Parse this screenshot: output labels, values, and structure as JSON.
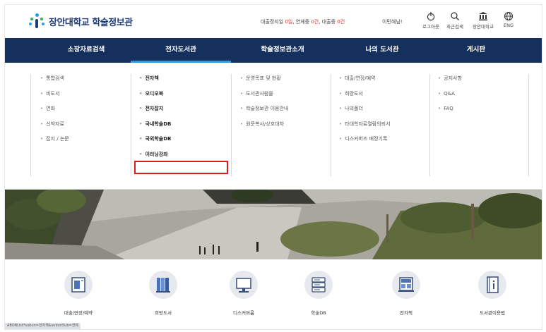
{
  "header": {
    "logo_text": "장안대학교 학술정보관",
    "status": {
      "prefix": "대출정지일 ",
      "suspend_days": "0일",
      "mid1": ", 연체중 ",
      "overdue": "0건",
      "mid2": ", 대출중 ",
      "loans": "0건"
    },
    "greeting": "이민혜님!",
    "utils": [
      {
        "label": "로그아웃",
        "icon": "power-icon"
      },
      {
        "label": "최근검색",
        "icon": "search-icon"
      },
      {
        "label": "장안대학교",
        "icon": "building-icon"
      },
      {
        "label": "ENG",
        "icon": "globe-icon"
      }
    ]
  },
  "nav": {
    "items": [
      {
        "label": "소장자료검색"
      },
      {
        "label": "전자도서관"
      },
      {
        "label": "학술정보관소개"
      },
      {
        "label": "나의 도서관"
      },
      {
        "label": "게시판"
      }
    ],
    "active_index": 1
  },
  "mega_menu": {
    "columns": [
      [
        "통합검색",
        "비도서",
        "연화",
        "신착자료",
        "잡지 / 논문"
      ],
      [
        "전자책",
        "오디오북",
        "전자잡지",
        "국내학술DB",
        "국외학술DB",
        "이러닝강좌"
      ],
      [
        "운영목표 및 현황",
        "도서관사람들",
        "학술정보관 이용안내",
        "원문복사/상호대차"
      ],
      [
        "대출/연장/예약",
        "희망도서",
        "나의폴더",
        "타대학자료열람의뢰서",
        "디스커버즈 배정기록"
      ],
      [
        "공지사항",
        "Q&A",
        "FAQ"
      ]
    ],
    "highlighted_item": "이러닝강좌"
  },
  "quick_links": [
    {
      "label": "대출/연장/예약",
      "icon": "book-loan-icon"
    },
    {
      "label": "희망도서",
      "icon": "bookshelf-icon"
    },
    {
      "label": "디스커버룸",
      "icon": "monitor-icon"
    },
    {
      "label": "학술DB",
      "icon": "database-icon"
    },
    {
      "label": "전자책",
      "icon": "ebook-icon"
    },
    {
      "label": "도서관이용법",
      "icon": "info-guide-icon"
    }
  ],
  "status_bar": {
    "url": "ABOBList?subun=전자책&subunSub=전체"
  },
  "colors": {
    "nav_bg": "#16305e",
    "accent_blue": "#2d9be0",
    "highlight_red": "#e01b1b",
    "status_red": "#e0312e"
  }
}
